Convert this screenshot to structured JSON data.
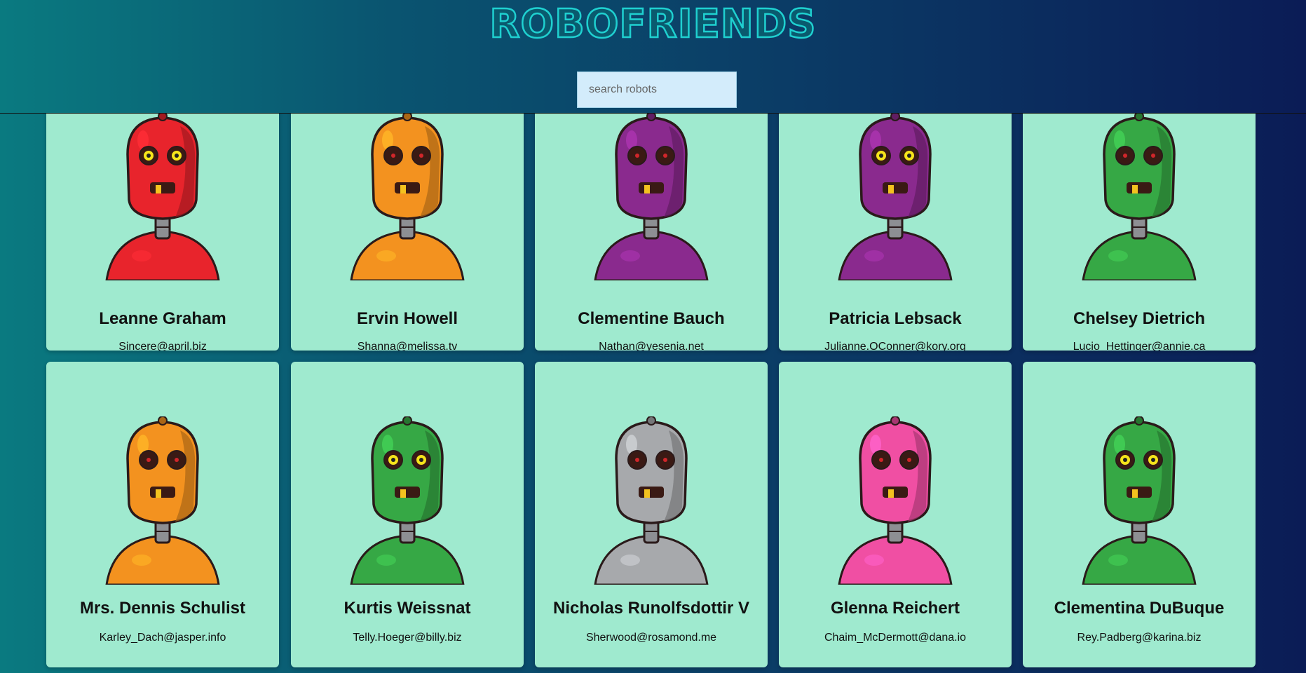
{
  "app": {
    "logo_text": "ROBOFRIENDS"
  },
  "search": {
    "placeholder": "search robots",
    "value": ""
  },
  "robots": [
    {
      "name": "Leanne Graham",
      "email": "Sincere@april.biz",
      "color": "#e8242c",
      "icon": "robot-red-icon"
    },
    {
      "name": "Ervin Howell",
      "email": "Shanna@melissa.tv",
      "color": "#f3921f",
      "icon": "robot-orange-icon"
    },
    {
      "name": "Clementine Bauch",
      "email": "Nathan@yesenia.net",
      "color": "#8a2a8e",
      "icon": "robot-purple-icon"
    },
    {
      "name": "Patricia Lebsack",
      "email": "Julianne.OConner@kory.org",
      "color": "#8a2a8e",
      "icon": "robot-purple-icon"
    },
    {
      "name": "Chelsey Dietrich",
      "email": "Lucio_Hettinger@annie.ca",
      "color": "#36a845",
      "icon": "robot-green-icon"
    },
    {
      "name": "Mrs. Dennis Schulist",
      "email": "Karley_Dach@jasper.info",
      "color": "#f3921f",
      "icon": "robot-orange-icon"
    },
    {
      "name": "Kurtis Weissnat",
      "email": "Telly.Hoeger@billy.biz",
      "color": "#36a845",
      "icon": "robot-green-icon"
    },
    {
      "name": "Nicholas Runolfsdottir V",
      "email": "Sherwood@rosamond.me",
      "color": "#a7a9ac",
      "icon": "robot-gray-icon"
    },
    {
      "name": "Glenna Reichert",
      "email": "Chaim_McDermott@dana.io",
      "color": "#f04fa3",
      "icon": "robot-pink-icon"
    },
    {
      "name": "Clementina DuBuque",
      "email": "Rey.Padberg@karina.biz",
      "color": "#36a845",
      "icon": "robot-green-icon"
    }
  ]
}
